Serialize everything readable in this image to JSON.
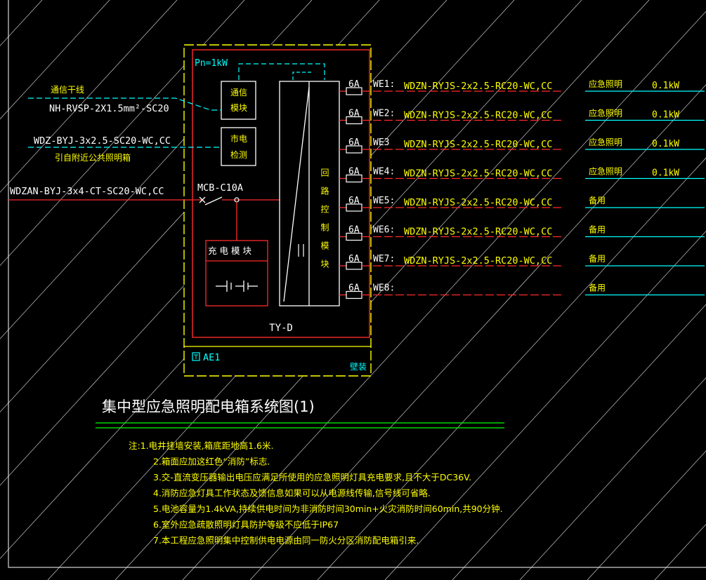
{
  "panel": {
    "power": "Pn=1kW",
    "signal_in_label": "通信干线",
    "signal_in_cable": "NH-RVSP-2X1.5mm²-SC20",
    "comm_module": [
      "通信",
      "模块"
    ],
    "mains_cable": "WDZ-BYJ-3x2.5-SC20-WC,CC",
    "mains_note": "引自附近公共照明箱",
    "mains_detect": [
      "市电",
      "检测"
    ],
    "supply_cable": "WDZAN-BYJ-3x4-CT-SC20-WC,CC",
    "breaker": "MCB-C10A",
    "charge_module": "充电模块",
    "inverter_label": "回路控制模块",
    "model": "TY-D",
    "box_id": "AE1",
    "mount": "壁装"
  },
  "circuits": [
    {
      "breaker": "6A",
      "id": "WE1:",
      "cable": "WDZN-RYJS-2x2.5-RC20-WC,CC",
      "use": "应急照明",
      "load": "0.1kW"
    },
    {
      "breaker": "6A",
      "id": "WE2:",
      "cable": "WDZN-RYJS-2x2.5-RC20-WC,CC",
      "use": "应急照明",
      "load": "0.1kW"
    },
    {
      "breaker": "6A",
      "id": "WE3",
      "cable": "WDZN-RYJS-2x2.5-RC20-WC,CC",
      "use": "应急照明",
      "load": "0.1kW"
    },
    {
      "breaker": "6A",
      "id": "WE4:",
      "cable": "WDZN-RYJS-2x2.5-RC20-WC,CC",
      "use": "应急照明",
      "load": "0.1kW"
    },
    {
      "breaker": "6A",
      "id": "WE5:",
      "cable": "WDZN-RYJS-2x2.5-RC20-WC,CC",
      "use": "备用",
      "load": ""
    },
    {
      "breaker": "6A",
      "id": "WE6:",
      "cable": "WDZN-RYJS-2x2.5-RC20-WC,CC",
      "use": "备用",
      "load": ""
    },
    {
      "breaker": "6A",
      "id": "WE7:",
      "cable": "WDZN-RYJS-2x2.5-RC20-WC,CC",
      "use": "备用",
      "load": ""
    },
    {
      "breaker": "6A",
      "id": "WE8:",
      "cable": "",
      "use": "备用",
      "load": ""
    }
  ],
  "title": "集中型应急照明配电箱系统图(1)",
  "notes": [
    "注:1.电井挂墙安装,箱底距地高1.6米.",
    "2.箱面应加这红色“消防”标志.",
    "3.交-直流变压器输出电压应满足所使用的应急照明灯具充电要求,且不大于DC36V.",
    "4.消防应急灯具工作状态及馈信息如果可以从电源线传输,信号线可省略.",
    "5.电池容量为1.4kVA,持续供电时间为非消防时间30min+火灾消防时间60min,共90分钟.",
    "6.室外应急疏散照明灯具防护等级不应低于IP67",
    "7.本工程应急照明集中控制供电电源由同一防火分区消防配电箱引来."
  ],
  "colors": {
    "background": "#000000",
    "box_outline": "#ffff00",
    "panel": "#ff2a2a",
    "signal": "#00ffff",
    "cable_text": "#ffff00",
    "use_text": "#00ffff",
    "frame": "#ffffff",
    "title": "#ffffff",
    "underline": "#00ff00",
    "notes": "#ffff00"
  }
}
